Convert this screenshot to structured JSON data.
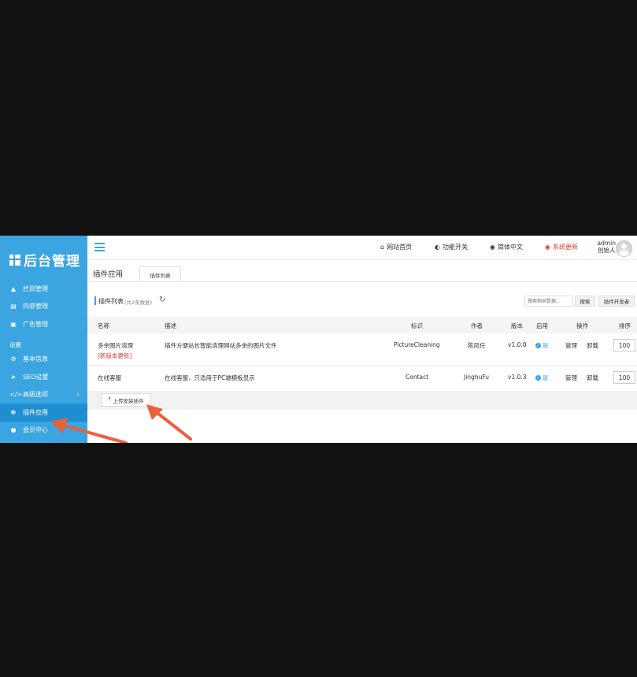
{
  "sidebar": {
    "logo_text": "后台管理",
    "items": [
      {
        "icon": "sitemap-icon",
        "label": "栏目管理"
      },
      {
        "icon": "list-icon",
        "label": "内容管理"
      },
      {
        "icon": "image-icon",
        "label": "广告管理"
      }
    ],
    "section_label": "设置",
    "settings_items": [
      {
        "icon": "gear-icon",
        "label": "基本信息"
      },
      {
        "icon": "paper-plane-icon",
        "label": "SEO设置"
      },
      {
        "icon": "code-icon",
        "label": "高级选项"
      },
      {
        "icon": "plugin-icon",
        "label": "插件应用"
      },
      {
        "icon": "user-icon",
        "label": "会员中心"
      }
    ]
  },
  "topbar": {
    "home": "网站首页",
    "toggle": "功能开关",
    "lang": "简体中文",
    "update": "系统更新",
    "user_name": "admin",
    "user_role": "创始人"
  },
  "page": {
    "title": "插件应用",
    "tab": "插件列表",
    "section_title": "插件列表",
    "section_count": "(共2条数据)",
    "search_placeholder": "搜索相关数据...",
    "search_button": "搜索",
    "developer_button": "插件开发者",
    "upload_button": "上传安装插件"
  },
  "table": {
    "headers": {
      "name": "名称",
      "desc": "描述",
      "ident": "标识",
      "author": "作者",
      "version": "版本",
      "enabled": "启用",
      "actions": "操作",
      "sort": "排序"
    },
    "rows": [
      {
        "name": "多余图片清理",
        "badge": "[新版本更新]",
        "desc": "插件方便站长智能清理网站多余的图片文件",
        "ident": "PictureCleaning",
        "author": "陈凤任",
        "version": "v1.0.0",
        "enabled": "是",
        "manage": "管理",
        "uninstall": "卸载",
        "sort": "100"
      },
      {
        "name": "在线客服",
        "badge": "",
        "desc": "在线客服，只适用于PC端模板显示",
        "ident": "Contact",
        "author": "JinghuFu",
        "version": "v1.0.3",
        "enabled": "是",
        "manage": "管理",
        "uninstall": "卸载",
        "sort": "100"
      }
    ]
  },
  "colors": {
    "sidebar": "#3aa5e0",
    "active": "#1f8ed0",
    "alert": "#e03a2f",
    "arrow": "#e8613a"
  }
}
